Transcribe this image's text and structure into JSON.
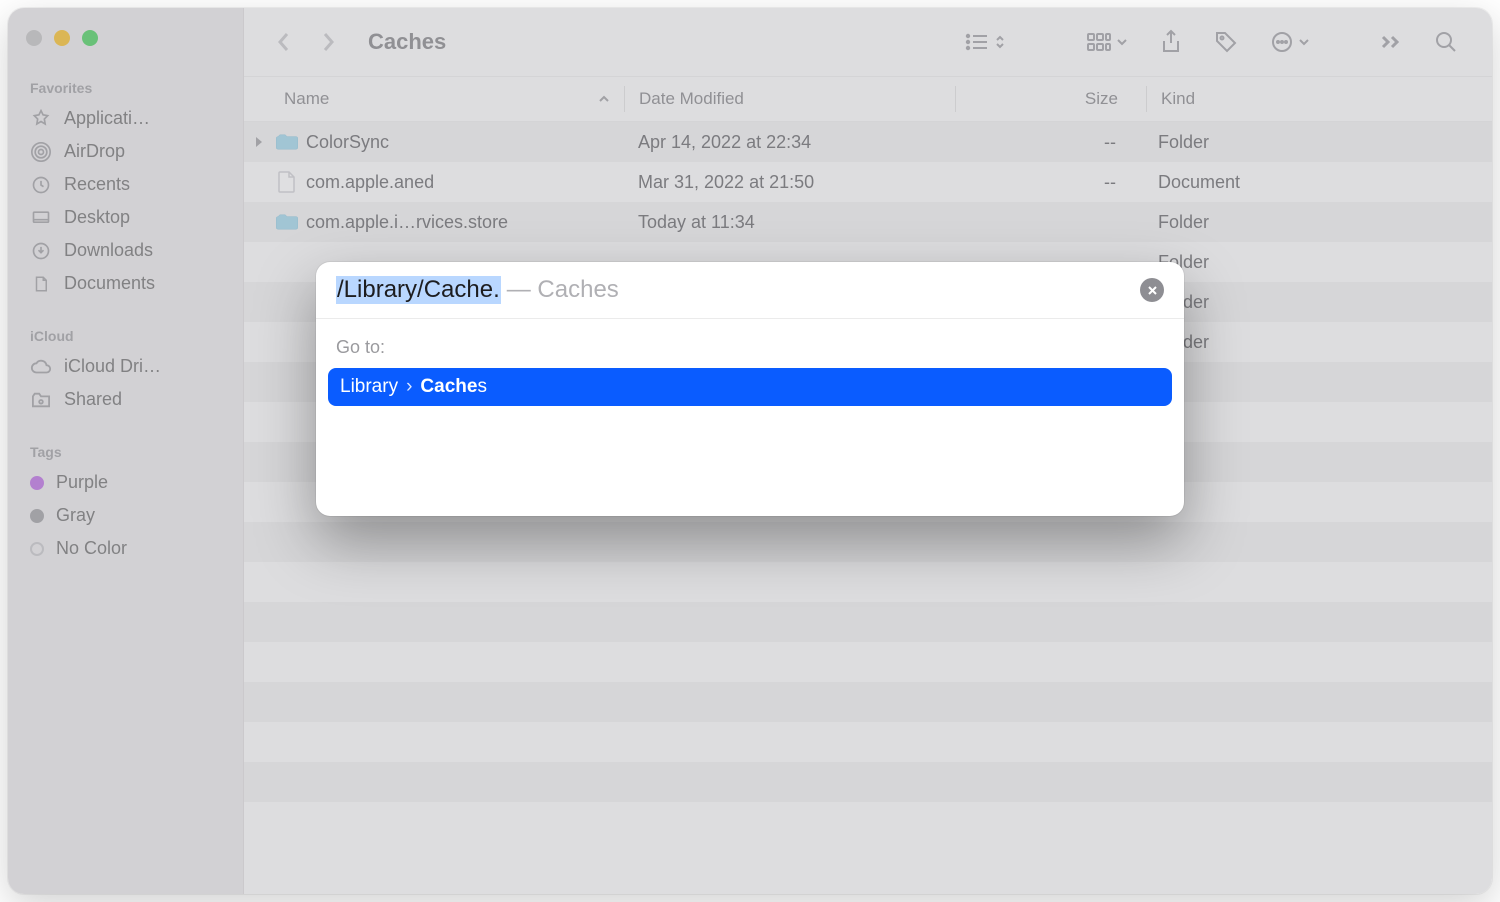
{
  "sidebar": {
    "sections": [
      {
        "label": "Favorites",
        "items": [
          {
            "label": "Applicati…",
            "icon": "apps"
          },
          {
            "label": "AirDrop",
            "icon": "airdrop"
          },
          {
            "label": "Recents",
            "icon": "clock"
          },
          {
            "label": "Desktop",
            "icon": "desktop"
          },
          {
            "label": "Downloads",
            "icon": "downloads"
          },
          {
            "label": "Documents",
            "icon": "document"
          }
        ]
      },
      {
        "label": "iCloud",
        "items": [
          {
            "label": "iCloud Dri…",
            "icon": "cloud"
          },
          {
            "label": "Shared",
            "icon": "shared"
          }
        ]
      },
      {
        "label": "Tags",
        "items": [
          {
            "label": "Purple",
            "icon": "tag",
            "color": "#af52de"
          },
          {
            "label": "Gray",
            "icon": "tag",
            "color": "#8e8e93"
          },
          {
            "label": "No Color",
            "icon": "tag",
            "color": "transparent"
          }
        ]
      }
    ]
  },
  "toolbar": {
    "title": "Caches"
  },
  "columns": {
    "name": "Name",
    "date": "Date Modified",
    "size": "Size",
    "kind": "Kind"
  },
  "files": [
    {
      "name": "ColorSync",
      "date": "Apr 14, 2022 at 22:34",
      "size": "--",
      "kind": "Folder",
      "type": "folder",
      "hasChildren": true
    },
    {
      "name": "com.apple.aned",
      "date": "Mar 31, 2022 at 21:50",
      "size": "--",
      "kind": "Document",
      "type": "document",
      "hasChildren": false
    },
    {
      "name": "com.apple.i…rvices.store",
      "date": "Today at 11:34",
      "size": "",
      "kind": "Folder",
      "type": "folder",
      "hasChildren": false
    },
    {
      "name": "",
      "date": "",
      "size": "",
      "kind": "Folder",
      "type": "blank",
      "hasChildren": false
    },
    {
      "name": "",
      "date": "",
      "size": "",
      "kind": "Folder",
      "type": "blank",
      "hasChildren": false
    },
    {
      "name": "",
      "date": "",
      "size": "",
      "kind": "Folder",
      "type": "blank",
      "hasChildren": false
    }
  ],
  "goto": {
    "typed": "/Library/Cache.",
    "completion_suffix": "— Caches",
    "label": "Go to:",
    "suggestion_prefix": "Library",
    "suggestion_bold": "Cache",
    "suggestion_tail": "s"
  }
}
